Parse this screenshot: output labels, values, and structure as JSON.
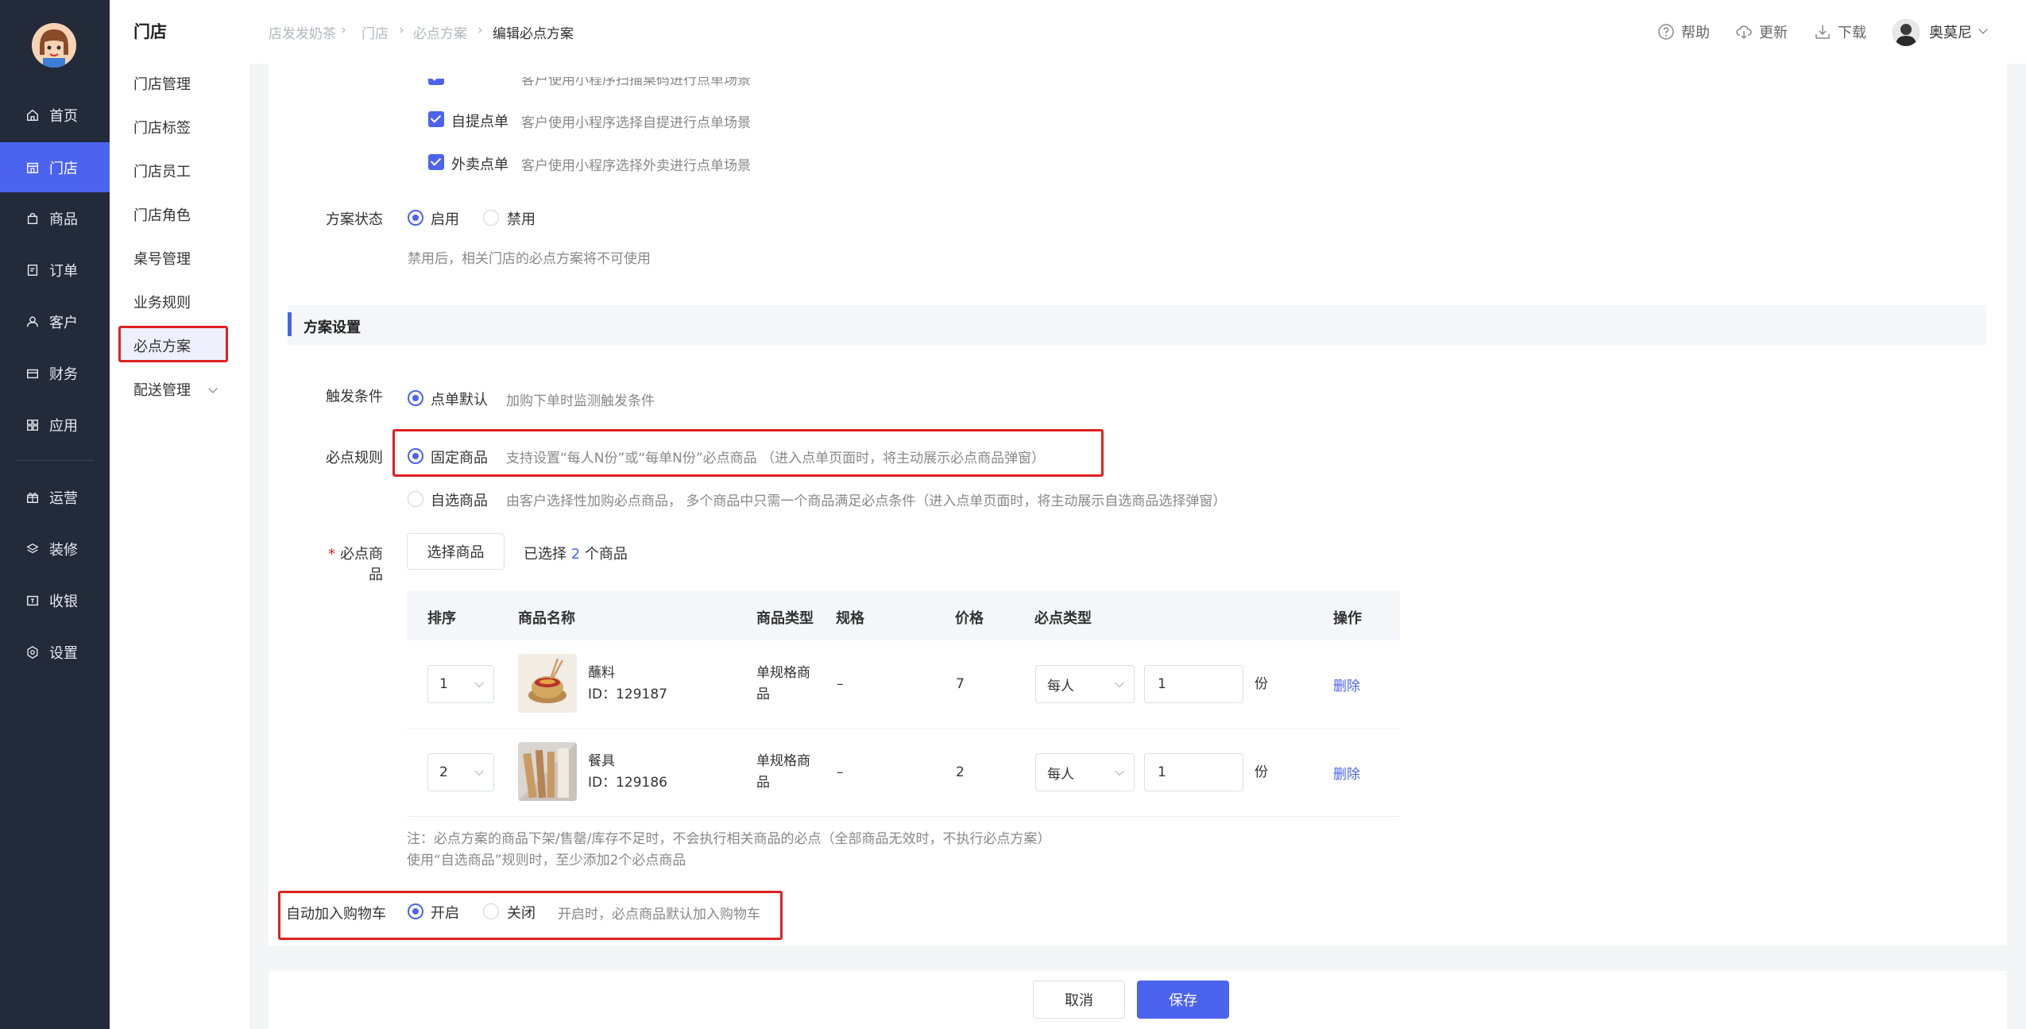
{
  "nav": {
    "items": [
      {
        "label": "首页",
        "icon": "home-icon"
      },
      {
        "label": "门店",
        "icon": "store-icon"
      },
      {
        "label": "商品",
        "icon": "bag-icon"
      },
      {
        "label": "订单",
        "icon": "order-icon"
      },
      {
        "label": "客户",
        "icon": "user-icon"
      },
      {
        "label": "财务",
        "icon": "card-icon"
      },
      {
        "label": "应用",
        "icon": "apps-icon"
      },
      {
        "label": "运营",
        "icon": "gift-icon"
      },
      {
        "label": "装修",
        "icon": "layers-icon"
      },
      {
        "label": "收银",
        "icon": "cashier-icon"
      },
      {
        "label": "设置",
        "icon": "settings-icon"
      }
    ],
    "active_color": "#4b63ee"
  },
  "subnav": {
    "title": "门店",
    "items": [
      "门店管理",
      "门店标签",
      "门店员工",
      "门店角色",
      "桌号管理",
      "业务规则",
      "必点方案",
      "配送管理"
    ]
  },
  "breadcrumb": [
    "店发发奶茶",
    "门店",
    "必点方案",
    "编辑必点方案"
  ],
  "topbar": {
    "help": "帮助",
    "update": "更新",
    "download": "下载",
    "username": "奥莫尼"
  },
  "form": {
    "partial_hint": "客户使用小程序扫描桌码进行点单场景",
    "scene_pickup_label": "自提点单",
    "scene_pickup_hint": "客户使用小程序选择自提进行点单场景",
    "scene_delivery_label": "外卖点单",
    "scene_delivery_hint": "客户使用小程序选择外卖进行点单场景",
    "status_label": "方案状态",
    "status_on": "启用",
    "status_off": "禁用",
    "status_hint": "禁用后，相关门店的必点方案将不可使用",
    "section_title": "方案设置",
    "trigger_label": "触发条件",
    "trigger_option": "点单默认",
    "trigger_hint": "加购下单时监测触发条件",
    "rule_label": "必点规则",
    "rule_fixed": "固定商品",
    "rule_fixed_hint": "支持设置“每人N份”或“每单N份”必点商品 （进入点单页面时，将主动展示必点商品弹窗）",
    "rule_optional": "自选商品",
    "rule_optional_hint": "由客户选择性加购必点商品， 多个商品中只需一个商品满足必点条件（进入点单页面时，将主动展示自选商品选择弹窗）",
    "required_star": "*",
    "goods_label": "必点商品",
    "select_goods_btn": "选择商品",
    "selected_prefix": "已选择",
    "selected_count": "2",
    "selected_suffix": "个商品",
    "note_1": "注：必点方案的商品下架/售罄/库存不足时，不会执行相关商品的必点（全部商品无效时，不执行必点方案）",
    "note_2": "使用“自选商品”规则时，至少添加2个必点商品",
    "auto_cart_label": "自动加入购物车",
    "auto_cart_on": "开启",
    "auto_cart_off": "关闭",
    "auto_cart_hint": "开启时，必点商品默认加入购物车"
  },
  "table": {
    "headers": [
      "排序",
      "商品名称",
      "商品类型",
      "规格",
      "价格",
      "必点类型",
      "操作"
    ],
    "rows": [
      {
        "order": "1",
        "name": "蘸料",
        "id": "ID：129187",
        "type_line1": "单规格商",
        "type_line2": "品",
        "spec": "–",
        "price": "7",
        "must_type": "每人",
        "qty": "1",
        "unit": "份",
        "action": "删除"
      },
      {
        "order": "2",
        "name": "餐具",
        "id": "ID：129186",
        "type_line1": "单规格商",
        "type_line2": "品",
        "spec": "–",
        "price": "2",
        "must_type": "每人",
        "qty": "1",
        "unit": "份",
        "action": "删除"
      }
    ]
  },
  "footer": {
    "cancel": "取消",
    "save": "保存"
  }
}
